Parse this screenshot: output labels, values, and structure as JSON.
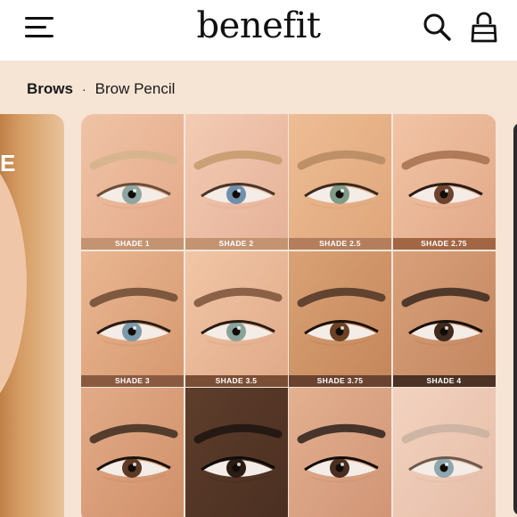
{
  "header": {
    "logo_text": "benefit",
    "menu_icon": "hamburger-menu-icon",
    "search_icon": "search-icon",
    "bag_icon": "shopping-bag-icon"
  },
  "breadcrumb": {
    "category": "Brows",
    "separator": "·",
    "product": "Brow Pencil"
  },
  "side_card": {
    "visible_letter": "E"
  },
  "shades": [
    {
      "label": "SHADE 1",
      "skin": "#f0c3a5",
      "skin_dark": "#e3a98a",
      "brow": "#d5b48c",
      "iris": "#8fa6a0",
      "band": "#c49371",
      "lash": "#6b4e3a"
    },
    {
      "label": "SHADE 2",
      "skin": "#f3cbb4",
      "skin_dark": "#e5b197",
      "brow": "#c49a6c",
      "iris": "#6f8fae",
      "band": "#c49371",
      "lash": "#4a3428"
    },
    {
      "label": "SHADE 2.5",
      "skin": "#eebd94",
      "skin_dark": "#dfa57a",
      "brow": "#b58a62",
      "iris": "#7f9a86",
      "band": "#b47e5d",
      "lash": "#3a2a20"
    },
    {
      "label": "SHADE 2.75",
      "skin": "#f1c4a5",
      "skin_dark": "#e1a888",
      "brow": "#a5704c",
      "iris": "#6d4330",
      "band": "#a26645",
      "lash": "#2a1c16"
    },
    {
      "label": "SHADE 3",
      "skin": "#e9b792",
      "skin_dark": "#d6986f",
      "brow": "#6b4a34",
      "iris": "#7c9aaa",
      "band": "#8a5a40",
      "lash": "#2a1c16"
    },
    {
      "label": "SHADE 3.5",
      "skin": "#f1c6a6",
      "skin_dark": "#e0a988",
      "brow": "#7a5238",
      "iris": "#8aa39a",
      "band": "#7a4e35",
      "lash": "#2a1c16"
    },
    {
      "label": "SHADE 3.75",
      "skin": "#d9a275",
      "skin_dark": "#c4865a",
      "brow": "#4e3526",
      "iris": "#6b4226",
      "band": "#6a4330",
      "lash": "#1c120d"
    },
    {
      "label": "SHADE 4",
      "skin": "#d8a07a",
      "skin_dark": "#c3865f",
      "brow": "#3a281e",
      "iris": "#3f2a1d",
      "band": "#4b3224",
      "lash": "#15100c"
    },
    {
      "label": "",
      "skin": "#e2ab88",
      "skin_dark": "#cf9069",
      "brow": "#3d2b20",
      "iris": "#5c3a26",
      "band": "",
      "lash": "#1a120d"
    },
    {
      "label": "",
      "skin": "#5e3d2b",
      "skin_dark": "#4a2f21",
      "brow": "#1d1410",
      "iris": "#2a1b13",
      "band": "",
      "lash": "#0e0a08"
    },
    {
      "label": "",
      "skin": "#e3b090",
      "skin_dark": "#d09575",
      "brow": "#2d201a",
      "iris": "#4a2e20",
      "band": "",
      "lash": "#120c09"
    },
    {
      "label": "",
      "skin": "#f2d3c0",
      "skin_dark": "#e6bca6",
      "brow": "#c9b2a0",
      "iris": "#8ea7ae",
      "band": "",
      "lash": "#6d5a4c"
    }
  ]
}
